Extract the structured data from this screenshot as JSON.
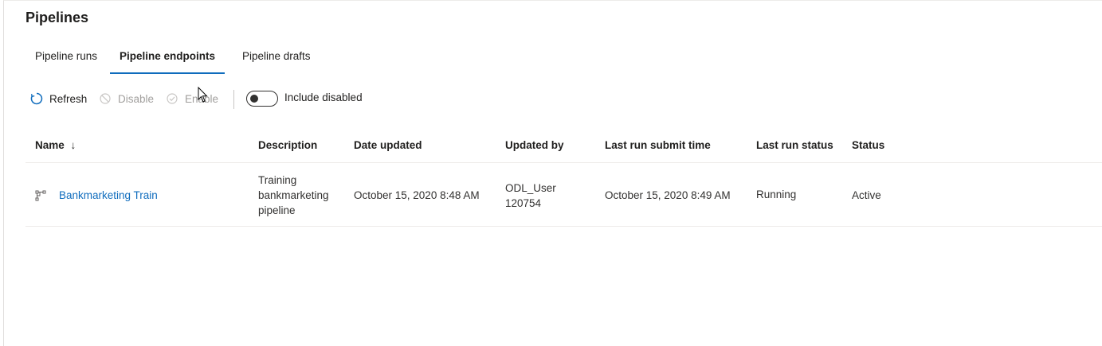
{
  "page": {
    "title": "Pipelines"
  },
  "tabs": [
    {
      "label": "Pipeline runs",
      "active": false
    },
    {
      "label": "Pipeline endpoints",
      "active": true
    },
    {
      "label": "Pipeline drafts",
      "active": false
    }
  ],
  "toolbar": {
    "refresh_label": "Refresh",
    "disable_label": "Disable",
    "enable_label": "Enable",
    "toggle_label": "Include disabled",
    "toggle_on": false
  },
  "table": {
    "columns": {
      "name": "Name",
      "name_sort_glyph": "↓",
      "description": "Description",
      "date_updated": "Date updated",
      "updated_by": "Updated by",
      "last_run_submit_time": "Last run submit time",
      "last_run_status": "Last run status",
      "status": "Status"
    },
    "rows": [
      {
        "name": "Bankmarketing Train",
        "description_lines": [
          "Training",
          "bankmarketing",
          "pipeline"
        ],
        "date_updated": "October 15, 2020 8:48 AM",
        "updated_by_lines": [
          "ODL_User",
          "120754"
        ],
        "last_run_submit_time": "October 15, 2020 8:49 AM",
        "last_run_status": "Running",
        "status": "Active"
      }
    ]
  },
  "colors": {
    "accent": "#0f6cbd",
    "text": "#201f1e",
    "disabled": "#a19f9d",
    "divider": "#edebe9"
  },
  "icons": {
    "refresh": "refresh-icon",
    "disable": "block-icon",
    "enable": "check-circle-icon",
    "pipeline": "pipeline-icon",
    "cursor": "mouse-pointer-icon"
  }
}
